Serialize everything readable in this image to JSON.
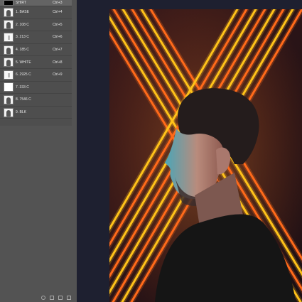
{
  "channels": [
    {
      "name": "SHIRT",
      "shortcut": "Ctrl+3",
      "thumb": "black"
    },
    {
      "name": "1. BASE",
      "shortcut": "Ctrl+4",
      "thumb": "fig"
    },
    {
      "name": "2. 108 C",
      "shortcut": "Ctrl+5",
      "thumb": "fig"
    },
    {
      "name": "3. 213 C",
      "shortcut": "Ctrl+6",
      "thumb": "light"
    },
    {
      "name": "4. 185 C",
      "shortcut": "Ctrl+7",
      "thumb": "fig"
    },
    {
      "name": "5. WHITE",
      "shortcut": "Ctrl+8",
      "thumb": "fig"
    },
    {
      "name": "6. 2925 C",
      "shortcut": "Ctrl+9",
      "thumb": "light"
    },
    {
      "name": "7. 333 C",
      "shortcut": "",
      "thumb": "white"
    },
    {
      "name": "8. 7546 C",
      "shortcut": "",
      "thumb": "fig"
    },
    {
      "name": "9. BLK",
      "shortcut": "",
      "thumb": "fig"
    }
  ],
  "colors": {
    "panel": "#535353",
    "workspace": "#1e2030",
    "neon_orange": "#ff6a1a",
    "neon_yellow": "#ffc21a",
    "jacket": "#151515",
    "hair": "#241c1c"
  },
  "footer_icons": [
    "dotted-circle-icon",
    "save-selection-icon",
    "new-channel-icon",
    "trash-icon"
  ]
}
